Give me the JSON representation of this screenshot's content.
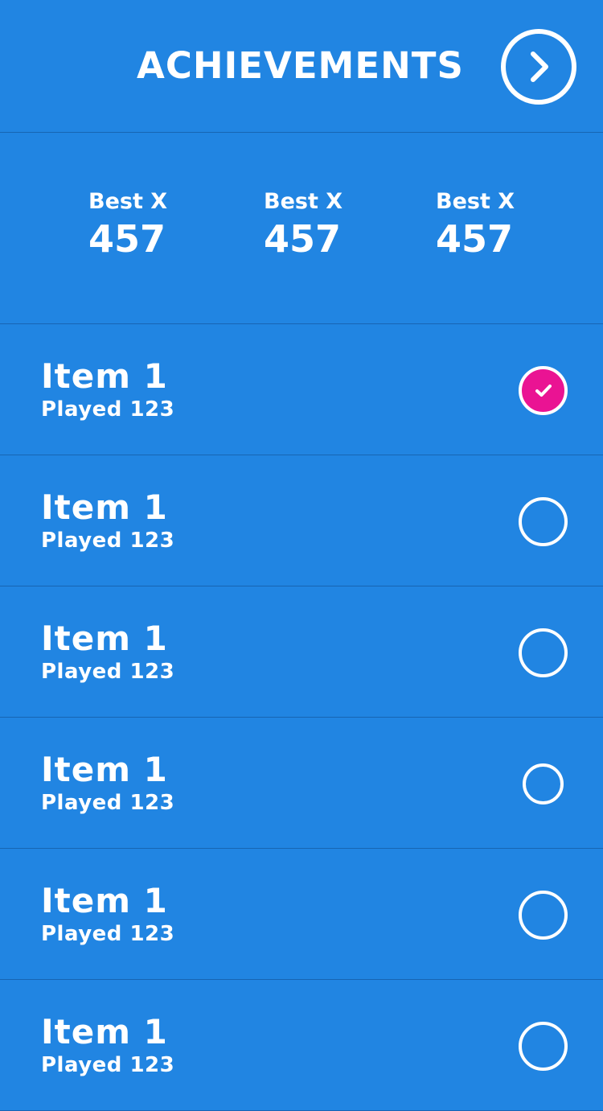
{
  "header": {
    "title": "ACHIEVEMENTS",
    "next_icon": "chevron-right-icon"
  },
  "stats": [
    {
      "label": "Best X",
      "value": "457"
    },
    {
      "label": "Best X",
      "value": "457"
    },
    {
      "label": "Best X",
      "value": "457"
    }
  ],
  "items": [
    {
      "title": "Item 1",
      "subtitle": "Played 123",
      "checked": true
    },
    {
      "title": "Item 1",
      "subtitle": "Played 123",
      "checked": false
    },
    {
      "title": "Item 1",
      "subtitle": "Played 123",
      "checked": false
    },
    {
      "title": "Item 1",
      "subtitle": "Played 123",
      "checked": false
    },
    {
      "title": "Item 1",
      "subtitle": "Played 123",
      "checked": false
    },
    {
      "title": "Item 1",
      "subtitle": "Played 123",
      "checked": false
    }
  ],
  "colors": {
    "background": "#2185e2",
    "divider": "#1765b3",
    "accent": "#ea1393",
    "foreground": "#ffffff"
  }
}
